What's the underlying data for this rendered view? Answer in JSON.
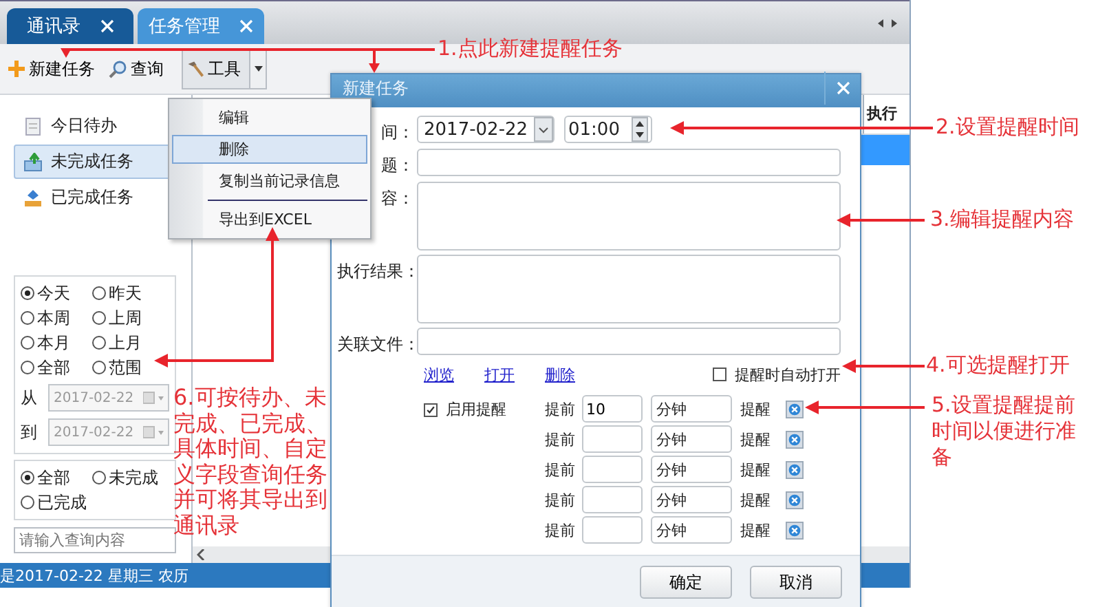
{
  "tabs": [
    {
      "label": "通讯录",
      "selected": false
    },
    {
      "label": "任务管理",
      "selected": true
    }
  ],
  "toolbar": [
    {
      "label": "新建任务",
      "kind": "new"
    },
    {
      "label": "查询",
      "kind": "search"
    },
    {
      "label": "工具",
      "kind": "tools"
    }
  ],
  "sidebar": {
    "items": [
      {
        "label": "今日待办",
        "kind": "today",
        "selected": false
      },
      {
        "label": "未完成任务",
        "kind": "open",
        "selected": true
      },
      {
        "label": "已完成任务",
        "kind": "done",
        "selected": false
      }
    ],
    "date_filter": {
      "options": [
        {
          "label": "今天",
          "selected": true
        },
        {
          "label": "昨天",
          "selected": false
        },
        {
          "label": "本周",
          "selected": false
        },
        {
          "label": "上周",
          "selected": false
        },
        {
          "label": "本月",
          "selected": false
        },
        {
          "label": "上月",
          "selected": false
        },
        {
          "label": "全部",
          "selected": false
        },
        {
          "label": "范围",
          "selected": false
        }
      ],
      "from_label": "从",
      "from_value": "2017-02-22",
      "to_label": "到",
      "to_value": "2017-02-22",
      "disabled": true
    },
    "status_filter": {
      "options": [
        {
          "label": "全部",
          "selected": true
        },
        {
          "label": "未完成",
          "selected": false
        },
        {
          "label": "已完成",
          "selected": false
        }
      ]
    },
    "search": {
      "placeholder": "请输入查询内容"
    }
  },
  "table": {
    "columns": [
      "执行"
    ],
    "rows": [
      {
        "selected": true
      }
    ]
  },
  "status_bar": "是2017-02-22 星期三 农历",
  "menu": {
    "items": [
      {
        "kind": "item",
        "label": "编辑",
        "selected": false
      },
      {
        "kind": "item",
        "label": "删除",
        "selected": true
      },
      {
        "kind": "item",
        "label": "复制当前记录信息",
        "selected": false
      },
      {
        "kind": "separator"
      },
      {
        "kind": "item",
        "label": "导出到EXCEL",
        "selected": false
      }
    ]
  },
  "dialog": {
    "title": "新建任务",
    "fields": [
      {
        "label": "间：",
        "kind": "datetime",
        "date": "2017-02-22",
        "time": "01:00"
      },
      {
        "label": "题：",
        "kind": "text"
      },
      {
        "label": "容：",
        "kind": "textarea"
      },
      {
        "label": "执行结果：",
        "kind": "textarea"
      },
      {
        "label": "关联文件：",
        "kind": "text"
      }
    ],
    "links": [
      "浏览",
      "打开",
      "删除"
    ],
    "auto_open": {
      "label": "提醒时自动打开",
      "checked": false
    },
    "enable_reminder": {
      "label": "启用提醒",
      "checked": true
    },
    "reminders": [
      {
        "before": "提前",
        "value": "10",
        "unit": "分钟",
        "after": "提醒"
      },
      {
        "before": "提前",
        "unit": "分钟",
        "after": "提醒"
      },
      {
        "before": "提前",
        "unit": "分钟",
        "after": "提醒"
      },
      {
        "before": "提前",
        "unit": "分钟",
        "after": "提醒"
      },
      {
        "before": "提前",
        "unit": "分钟",
        "after": "提醒"
      }
    ],
    "buttons": [
      "确定",
      "取消"
    ]
  },
  "annotations": [
    "1.点此新建提醒任务",
    "2.设置提醒时间",
    "3.编辑提醒内容",
    "4.可选提醒打开",
    "6.可按待办、未完成、已完成、具体时间、自定义字段查询任务并可将其导出到通讯录",
    "5.设置提醒提前时间以便进行准备"
  ]
}
